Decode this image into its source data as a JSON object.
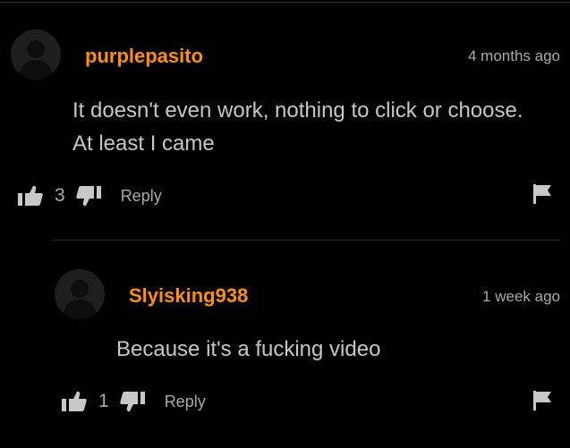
{
  "comments": [
    {
      "username": "purplepasito",
      "time": "4 months ago",
      "text_lines": [
        "It doesn't even work, nothing to click or choose.",
        "At least I came"
      ],
      "likes": "3",
      "reply_label": "Reply"
    },
    {
      "username": "Slyisking938",
      "time": "1 week ago",
      "text_lines": [
        "Because it's a fucking video"
      ],
      "likes": "1",
      "reply_label": "Reply"
    }
  ],
  "icons": {
    "like": "thumbs-up-icon",
    "dislike": "thumbs-down-icon",
    "flag": "flag-icon",
    "avatar": "user-silhouette-icon"
  },
  "colors": {
    "background": "#000000",
    "username": "#ff9000",
    "text": "#c6c6c6",
    "meta": "#a9a9a9"
  }
}
